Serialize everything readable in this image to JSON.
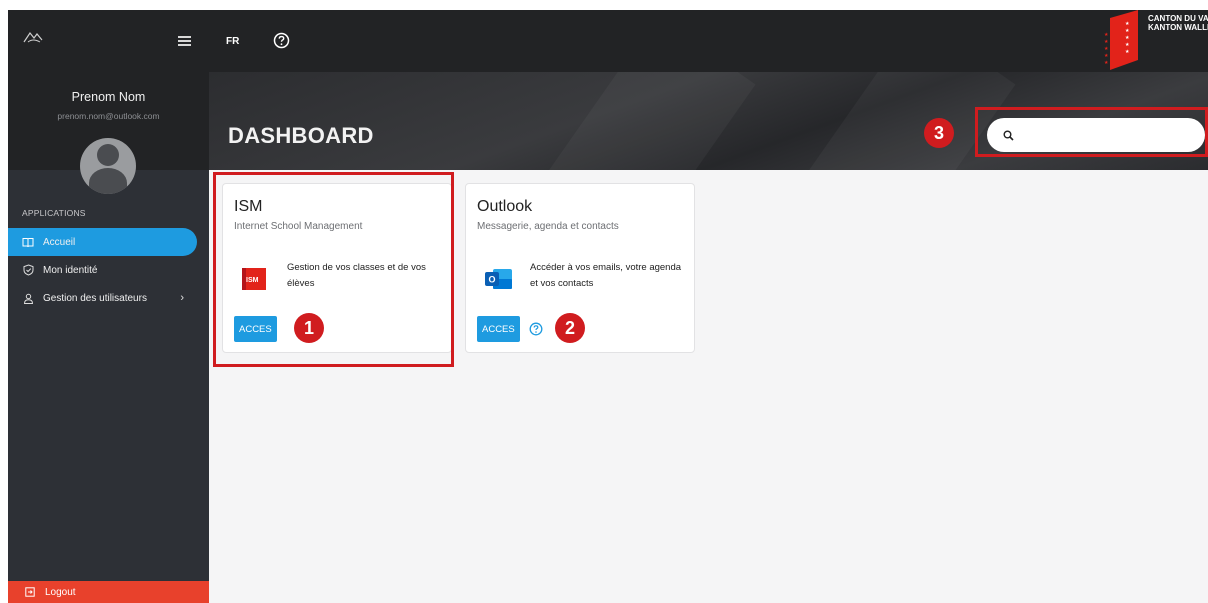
{
  "sidebar": {
    "user_name": "Prenom Nom",
    "user_email": "prenom.nom@outlook.com",
    "section_label": "APPLICATIONS",
    "items": [
      {
        "label": "Accueil",
        "icon": "book-icon",
        "active": true
      },
      {
        "label": "Mon identité",
        "icon": "shield-check-icon"
      },
      {
        "label": "Gestion des utilisateurs",
        "icon": "users-icon",
        "chevron": "›"
      }
    ],
    "logout_label": "Logout"
  },
  "topbar": {
    "lang": "FR",
    "canton_line1": "CANTON DU VALAIS",
    "canton_line2": "KANTON WALLIS"
  },
  "hero": {
    "title": "DASHBOARD",
    "search_placeholder": ""
  },
  "cards": [
    {
      "title": "ISM",
      "subtitle": "Internet School Management",
      "logo_text": "ISM",
      "description": "Gestion de vos classes et de vos élèves",
      "button": "ACCES"
    },
    {
      "title": "Outlook",
      "subtitle": "Messagerie, agenda et contacts",
      "logo_text": "O",
      "description": "Accéder à vos emails, votre agenda et vos contacts",
      "button": "ACCES"
    }
  ],
  "annotations": [
    "1",
    "2",
    "3"
  ],
  "colors": {
    "accent": "#1e9be0",
    "logout": "#e8412c",
    "highlight": "#d01c1f",
    "sidebar": "#2d3036",
    "topbar": "#222325"
  }
}
